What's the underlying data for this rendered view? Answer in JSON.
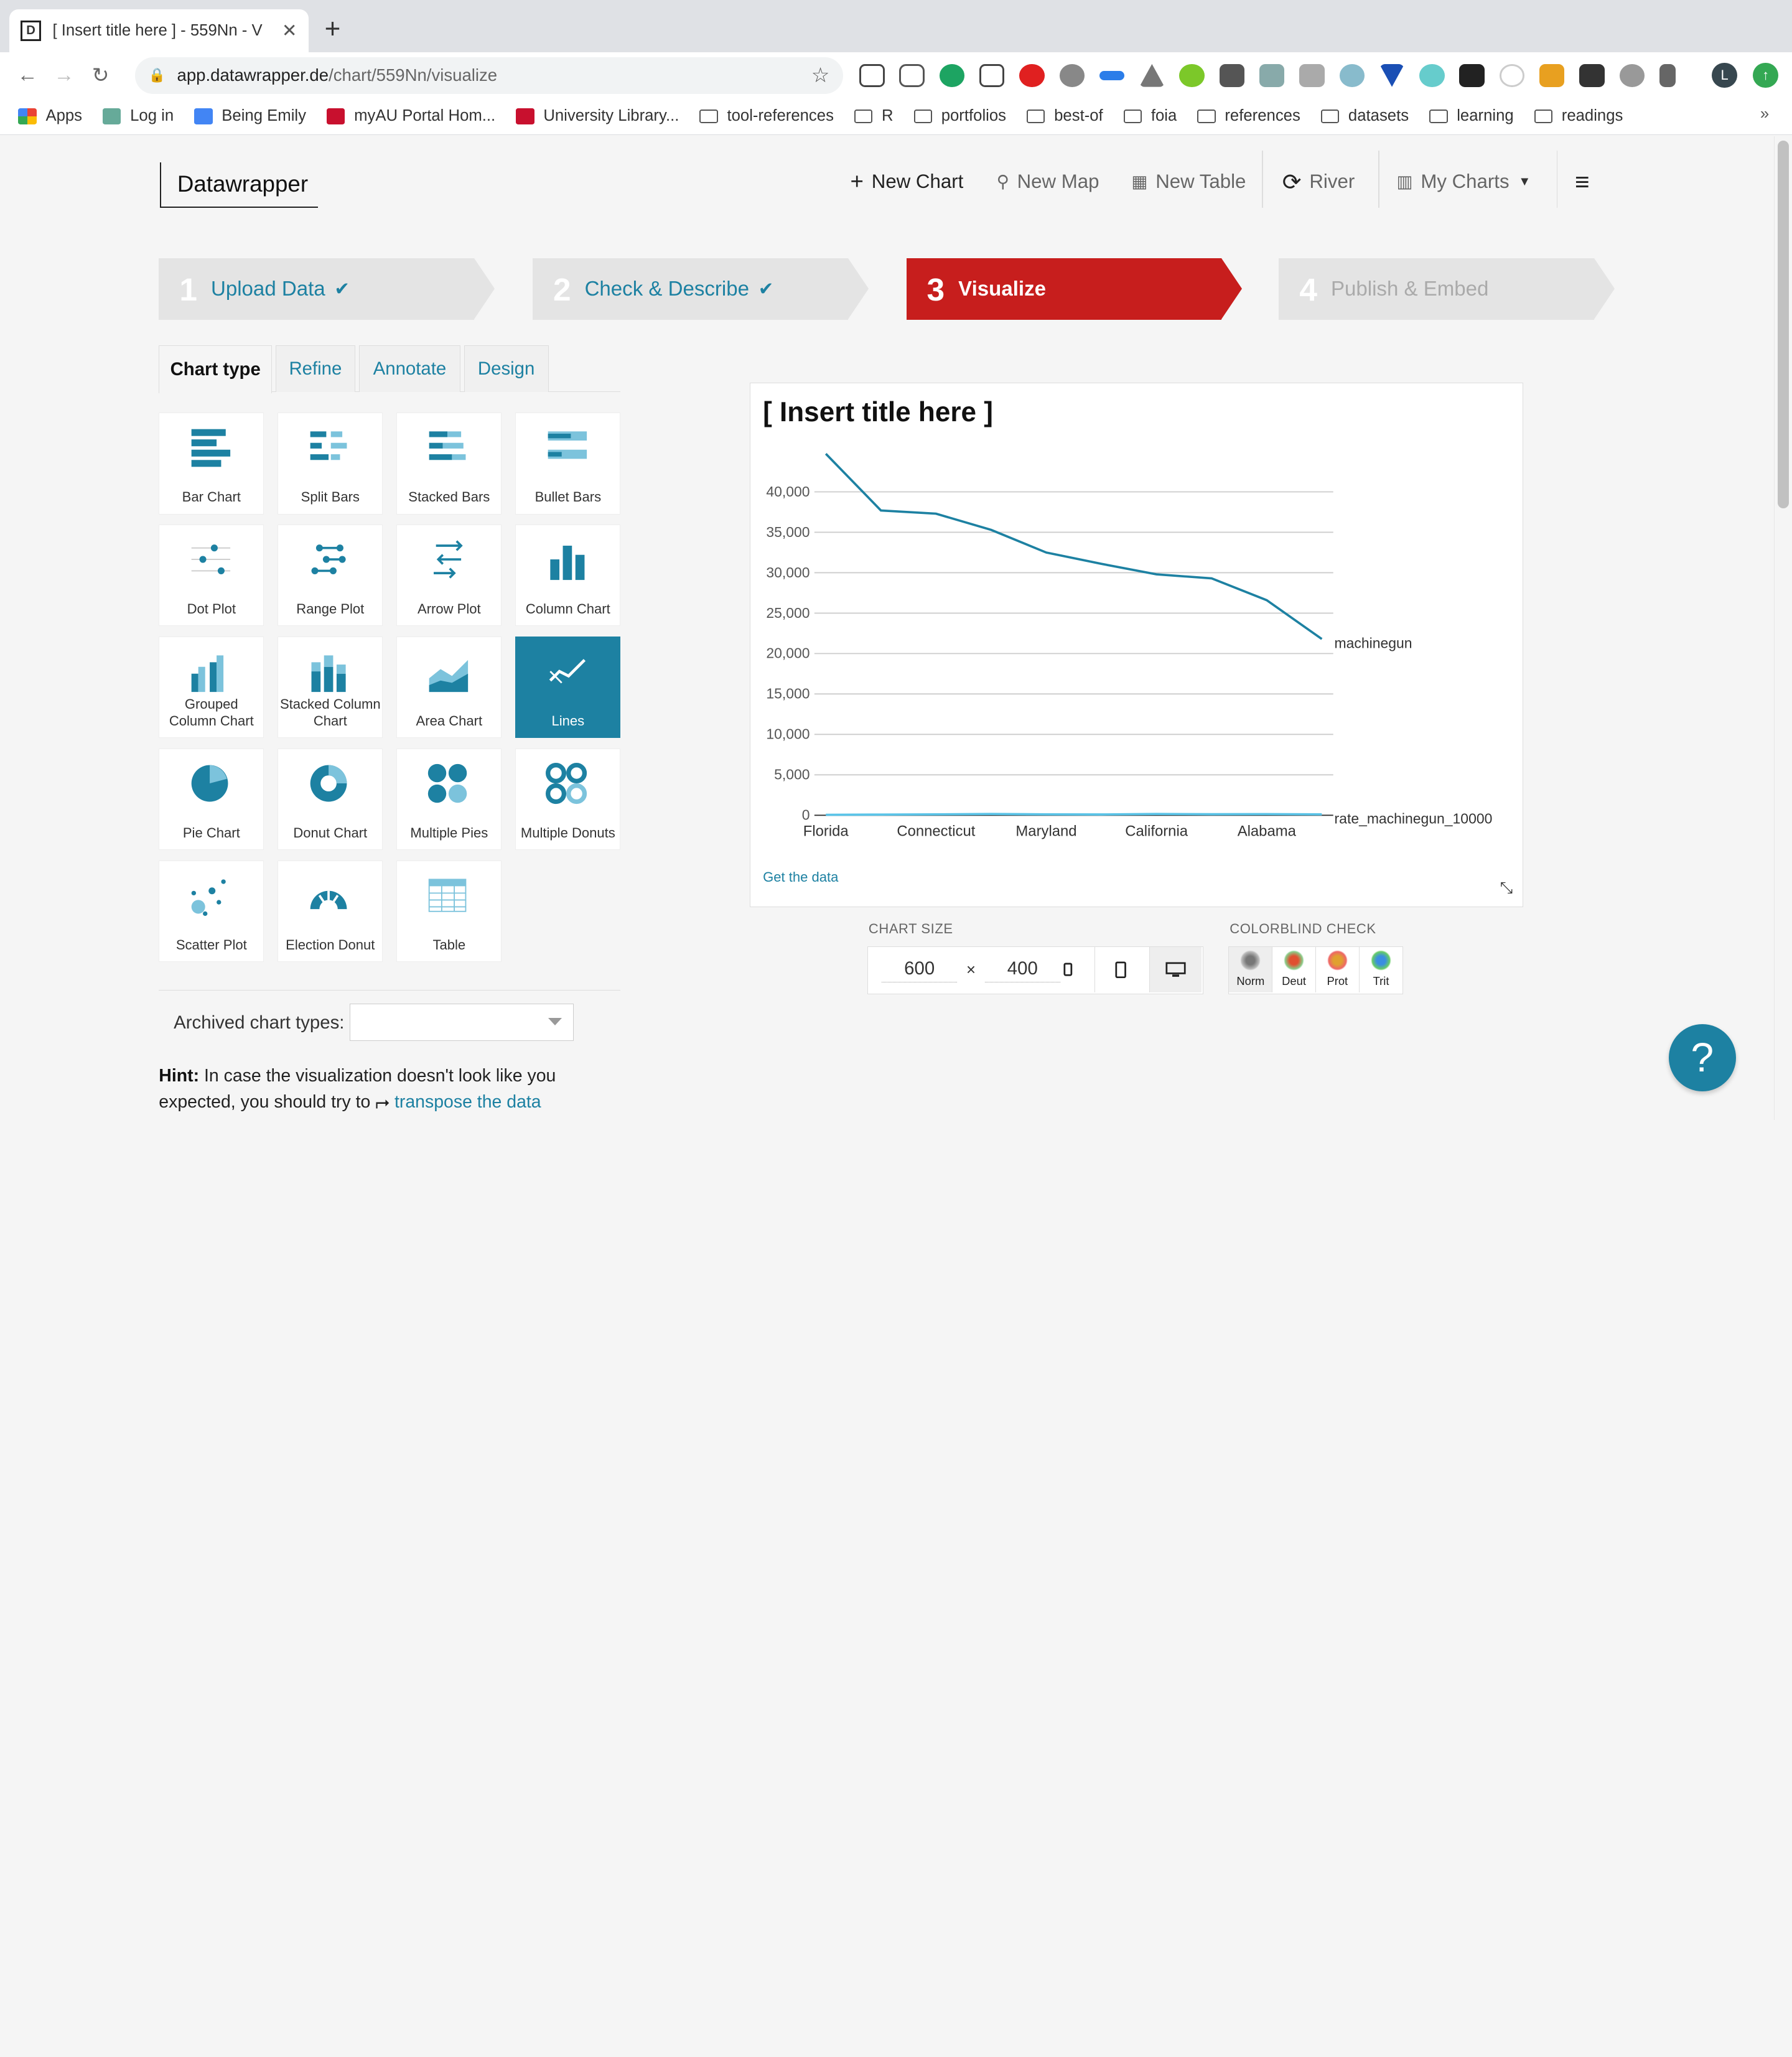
{
  "browser": {
    "tab_title": "[ Insert title here ] - 559Nn - V",
    "favicon": "D",
    "url_host": "app.datawrapper.de",
    "url_path": "/chart/559Nn/visualize",
    "profile_initial": "L",
    "bookmarks": [
      "Apps",
      "Log in",
      "Being Emily",
      "myAU Portal Hom...",
      "University Library...",
      "tool-references",
      "R",
      "portfolios",
      "best-of",
      "foia",
      "references",
      "datasets",
      "learning",
      "readings"
    ],
    "bookmarks_more": "»"
  },
  "app": {
    "logo": "Datawrapper",
    "nav": {
      "new_chart": "New Chart",
      "new_map": "New Map",
      "new_table": "New Table",
      "river": "River",
      "my_charts": "My Charts"
    },
    "steps": [
      {
        "num": "1",
        "label": "Upload Data"
      },
      {
        "num": "2",
        "label": "Check & Describe"
      },
      {
        "num": "3",
        "label": "Visualize"
      },
      {
        "num": "4",
        "label": "Publish & Embed"
      }
    ],
    "tabs": [
      "Chart type",
      "Refine",
      "Annotate",
      "Design"
    ],
    "chart_types": [
      "Bar Chart",
      "Split Bars",
      "Stacked Bars",
      "Bullet Bars",
      "Dot Plot",
      "Range Plot",
      "Arrow Plot",
      "Column Chart",
      "Grouped Column Chart",
      "Stacked Column Chart",
      "Area Chart",
      "Lines",
      "Pie Chart",
      "Donut Chart",
      "Multiple Pies",
      "Multiple Donuts",
      "Scatter Plot",
      "Election Donut",
      "Table"
    ],
    "selected_chart_type": "Lines",
    "archived_label": "Archived chart types:",
    "hint_bold": "Hint:",
    "hint_text": "In case the visualization doesn't look like you expected, you should try to",
    "hint_link": "transpose the data",
    "chart_size_label": "CHART SIZE",
    "chart_width": "600",
    "chart_height": "400",
    "size_x": "×",
    "colorblind_label": "COLORBLIND CHECK",
    "colorblind_modes": [
      "Norm",
      "Deut",
      "Prot",
      "Trit"
    ],
    "help": "?",
    "accent_color": "#1d81a2",
    "step_active_color": "#c71e1d"
  },
  "chart": {
    "title": "[ Insert title here ]",
    "get_data": "Get the data"
  },
  "chart_data": {
    "type": "line",
    "title": "[ Insert title here ]",
    "x_labels": [
      "Florida",
      "Connecticut",
      "Maryland",
      "California",
      "Alabama"
    ],
    "ylim": [
      0,
      40000
    ],
    "y_ticks": [
      0,
      5000,
      10000,
      15000,
      20000,
      25000,
      30000,
      35000,
      40000
    ],
    "y_tick_labels": [
      "0",
      "5,000",
      "10,000",
      "15,000",
      "20,000",
      "25,000",
      "30,000",
      "35,000",
      "40,000"
    ],
    "series": [
      {
        "name": "machinegun",
        "color": "#1d81a2",
        "values": [
          44700,
          37700,
          37300,
          35300,
          32500,
          31100,
          29800,
          29300,
          26600,
          21800
        ]
      },
      {
        "name": "rate_machinegun_10000",
        "color": "#5bc4e8",
        "values": [
          50,
          80,
          110,
          150,
          120,
          100,
          160,
          130,
          140,
          120
        ]
      }
    ],
    "grid": true,
    "legend": "inline-end-labels"
  }
}
